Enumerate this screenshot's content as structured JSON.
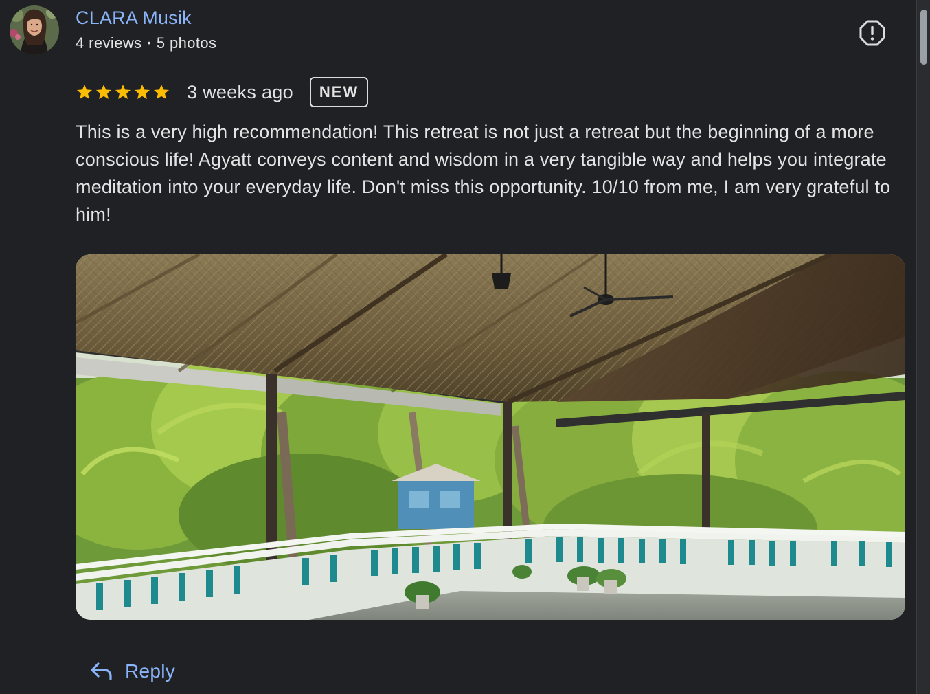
{
  "reviewer": {
    "name": "CLARA Musik",
    "reviews_count": "4 reviews",
    "separator": "•",
    "photos_count": "5 photos"
  },
  "rating": {
    "stars": 5,
    "max_stars": 5,
    "date": "3 weeks ago",
    "badge": "NEW"
  },
  "review": {
    "text": "This is a very high recommendation! This retreat is not just a retreat but the beginning of a more conscious life! Agyatt conveys content and wisdom in a very tangible way and helps you integrate meditation into your everyday life. Don't miss this opportunity. 10/10 from me, I am very grateful to him!"
  },
  "actions": {
    "reply_label": "Reply",
    "report_icon": "report-icon",
    "reply_icon": "reply-arrow-icon"
  },
  "colors": {
    "background": "#202124",
    "link": "#8ab4f8",
    "star": "#fbbc04",
    "text": "#e3e3e3"
  }
}
